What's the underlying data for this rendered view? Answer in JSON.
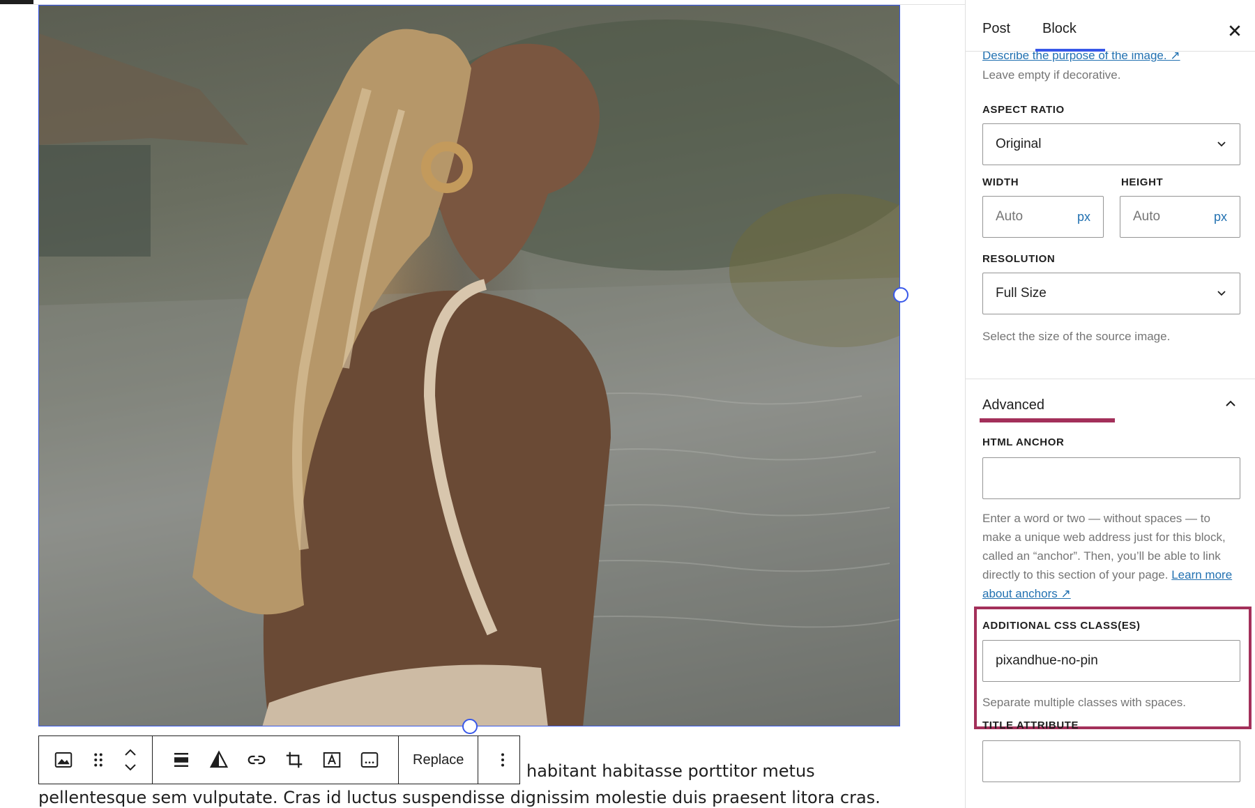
{
  "editor": {
    "image_alt": "Woman with long wavy blonde hair beside an infinity pool",
    "toolbar": {
      "replace_label": "Replace"
    },
    "paragraph": {
      "line1": "habitant habitasse porttitor metus",
      "line2": "pellentesque sem vulputate. Cras id luctus suspendisse dignissim molestie duis praesent litora cras."
    }
  },
  "sidebar": {
    "tabs": [
      {
        "label": "Post",
        "active": false
      },
      {
        "label": "Block",
        "active": true
      }
    ],
    "alt_text": {
      "help_link": "Describe the purpose of the image. ↗",
      "help": "Leave empty if decorative."
    },
    "aspect_ratio": {
      "label": "ASPECT RATIO",
      "value": "Original"
    },
    "dimensions": {
      "width_label": "WIDTH",
      "height_label": "HEIGHT",
      "width_placeholder": "Auto",
      "height_placeholder": "Auto",
      "unit": "px"
    },
    "resolution": {
      "label": "RESOLUTION",
      "value": "Full Size",
      "help": "Select the size of the source image."
    },
    "advanced": {
      "title": "Advanced",
      "expanded": true,
      "html_anchor": {
        "label": "HTML ANCHOR",
        "value": "",
        "help": "Enter a word or two — without spaces — to make a unique web address just for this block, called an “anchor”. Then, you’ll be able to link directly to this section of your page.",
        "link": "Learn more about anchors ↗"
      },
      "css_classes": {
        "label": "ADDITIONAL CSS CLASS(ES)",
        "value": "pixandhue-no-pin",
        "help": "Separate multiple classes with spaces."
      },
      "title_attribute": {
        "label": "TITLE ATTRIBUTE",
        "value": ""
      }
    }
  },
  "colors": {
    "accent": "#3858e9",
    "highlight": "#a3305a",
    "link": "#2271b1"
  }
}
